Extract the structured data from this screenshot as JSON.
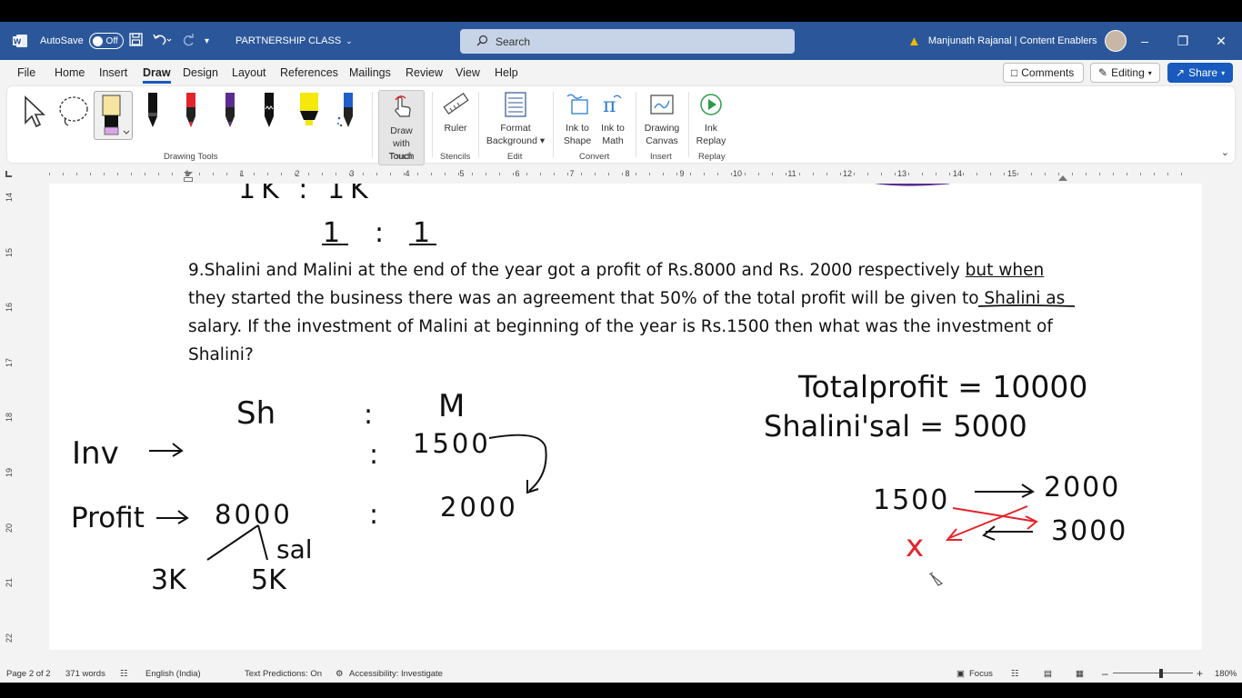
{
  "titlebar": {
    "autosave_label": "AutoSave",
    "autosave_state": "Off",
    "doc_name": "PARTNERSHIP CLASS",
    "search_placeholder": "Search",
    "user_name": "Manjunath Rajanal | Content Enablers"
  },
  "menu": {
    "tabs": [
      "File",
      "Home",
      "Insert",
      "Draw",
      "Design",
      "Layout",
      "References",
      "Mailings",
      "Review",
      "View",
      "Help"
    ],
    "active_tab": "Draw",
    "comments_label": "Comments",
    "editing_label": "Editing",
    "share_label": "Share"
  },
  "ribbon": {
    "groups": {
      "drawing_tools": "Drawing Tools",
      "touch": "Touch",
      "stencils": "Stencils",
      "edit": "Edit",
      "convert": "Convert",
      "insert": "Insert",
      "replay": "Replay"
    },
    "buttons": {
      "draw_with_touch_1": "Draw with",
      "draw_with_touch_2": "Touch",
      "ruler": "Ruler",
      "format_bg_1": "Format",
      "format_bg_2": "Background",
      "ink_to_shape_1": "Ink to",
      "ink_to_shape_2": "Shape",
      "ink_to_math_1": "Ink to",
      "ink_to_math_2": "Math",
      "drawing_canvas_1": "Drawing",
      "drawing_canvas_2": "Canvas",
      "ink_replay_1": "Ink",
      "ink_replay_2": "Replay"
    },
    "pen_colors": [
      "#111111",
      "#e3242b",
      "#5b2d8e",
      "#111111",
      "#f4e80c",
      "#1f5fc9"
    ]
  },
  "ruler": {
    "h_numbers": [
      "1",
      "1",
      "2",
      "3",
      "4",
      "5",
      "6",
      "7",
      "8",
      "9",
      "10",
      "11",
      "12",
      "13",
      "14",
      "15"
    ],
    "v_numbers": [
      "14",
      "15",
      "16",
      "17",
      "18",
      "19",
      "20",
      "21",
      "22"
    ]
  },
  "document": {
    "question_line1_a": "9.Shalini and Malini at the end of the year got a profit of Rs.8000 and Rs. 2000 respectively ",
    "question_line1_b": "but when",
    "question_rest": "they started the business there was an agreement that 50% of the total profit will be given to Shalini as salary. If the investment of Malini at beginning of the year is Rs.1500 then what was the investment of Shalini?",
    "ink": {
      "top_ratio_partial": "1K : 1K",
      "ratio_one": "1",
      "ratio_colon": ":",
      "ratio_two": "1",
      "sh": "Sh",
      "colon": ":",
      "m": "M",
      "inv": "Inv",
      "inv_val": "1500",
      "profit": "Profit",
      "profit_sh": "8000",
      "profit_m": "2000",
      "split_a": "3K",
      "split_b": "5K",
      "sal": "sal",
      "total_profit": "Totalprofit = 10000",
      "shalini_sal": "Shalini'sal = 5000",
      "prop_a": "1500",
      "prop_b": "2000",
      "prop_x": "x",
      "prop_c": "3000"
    }
  },
  "statusbar": {
    "page": "Page 2 of 2",
    "words": "371 words",
    "language": "English (India)",
    "predictions": "Text Predictions: On",
    "accessibility": "Accessibility: Investigate",
    "focus": "Focus",
    "zoom": "180%"
  }
}
